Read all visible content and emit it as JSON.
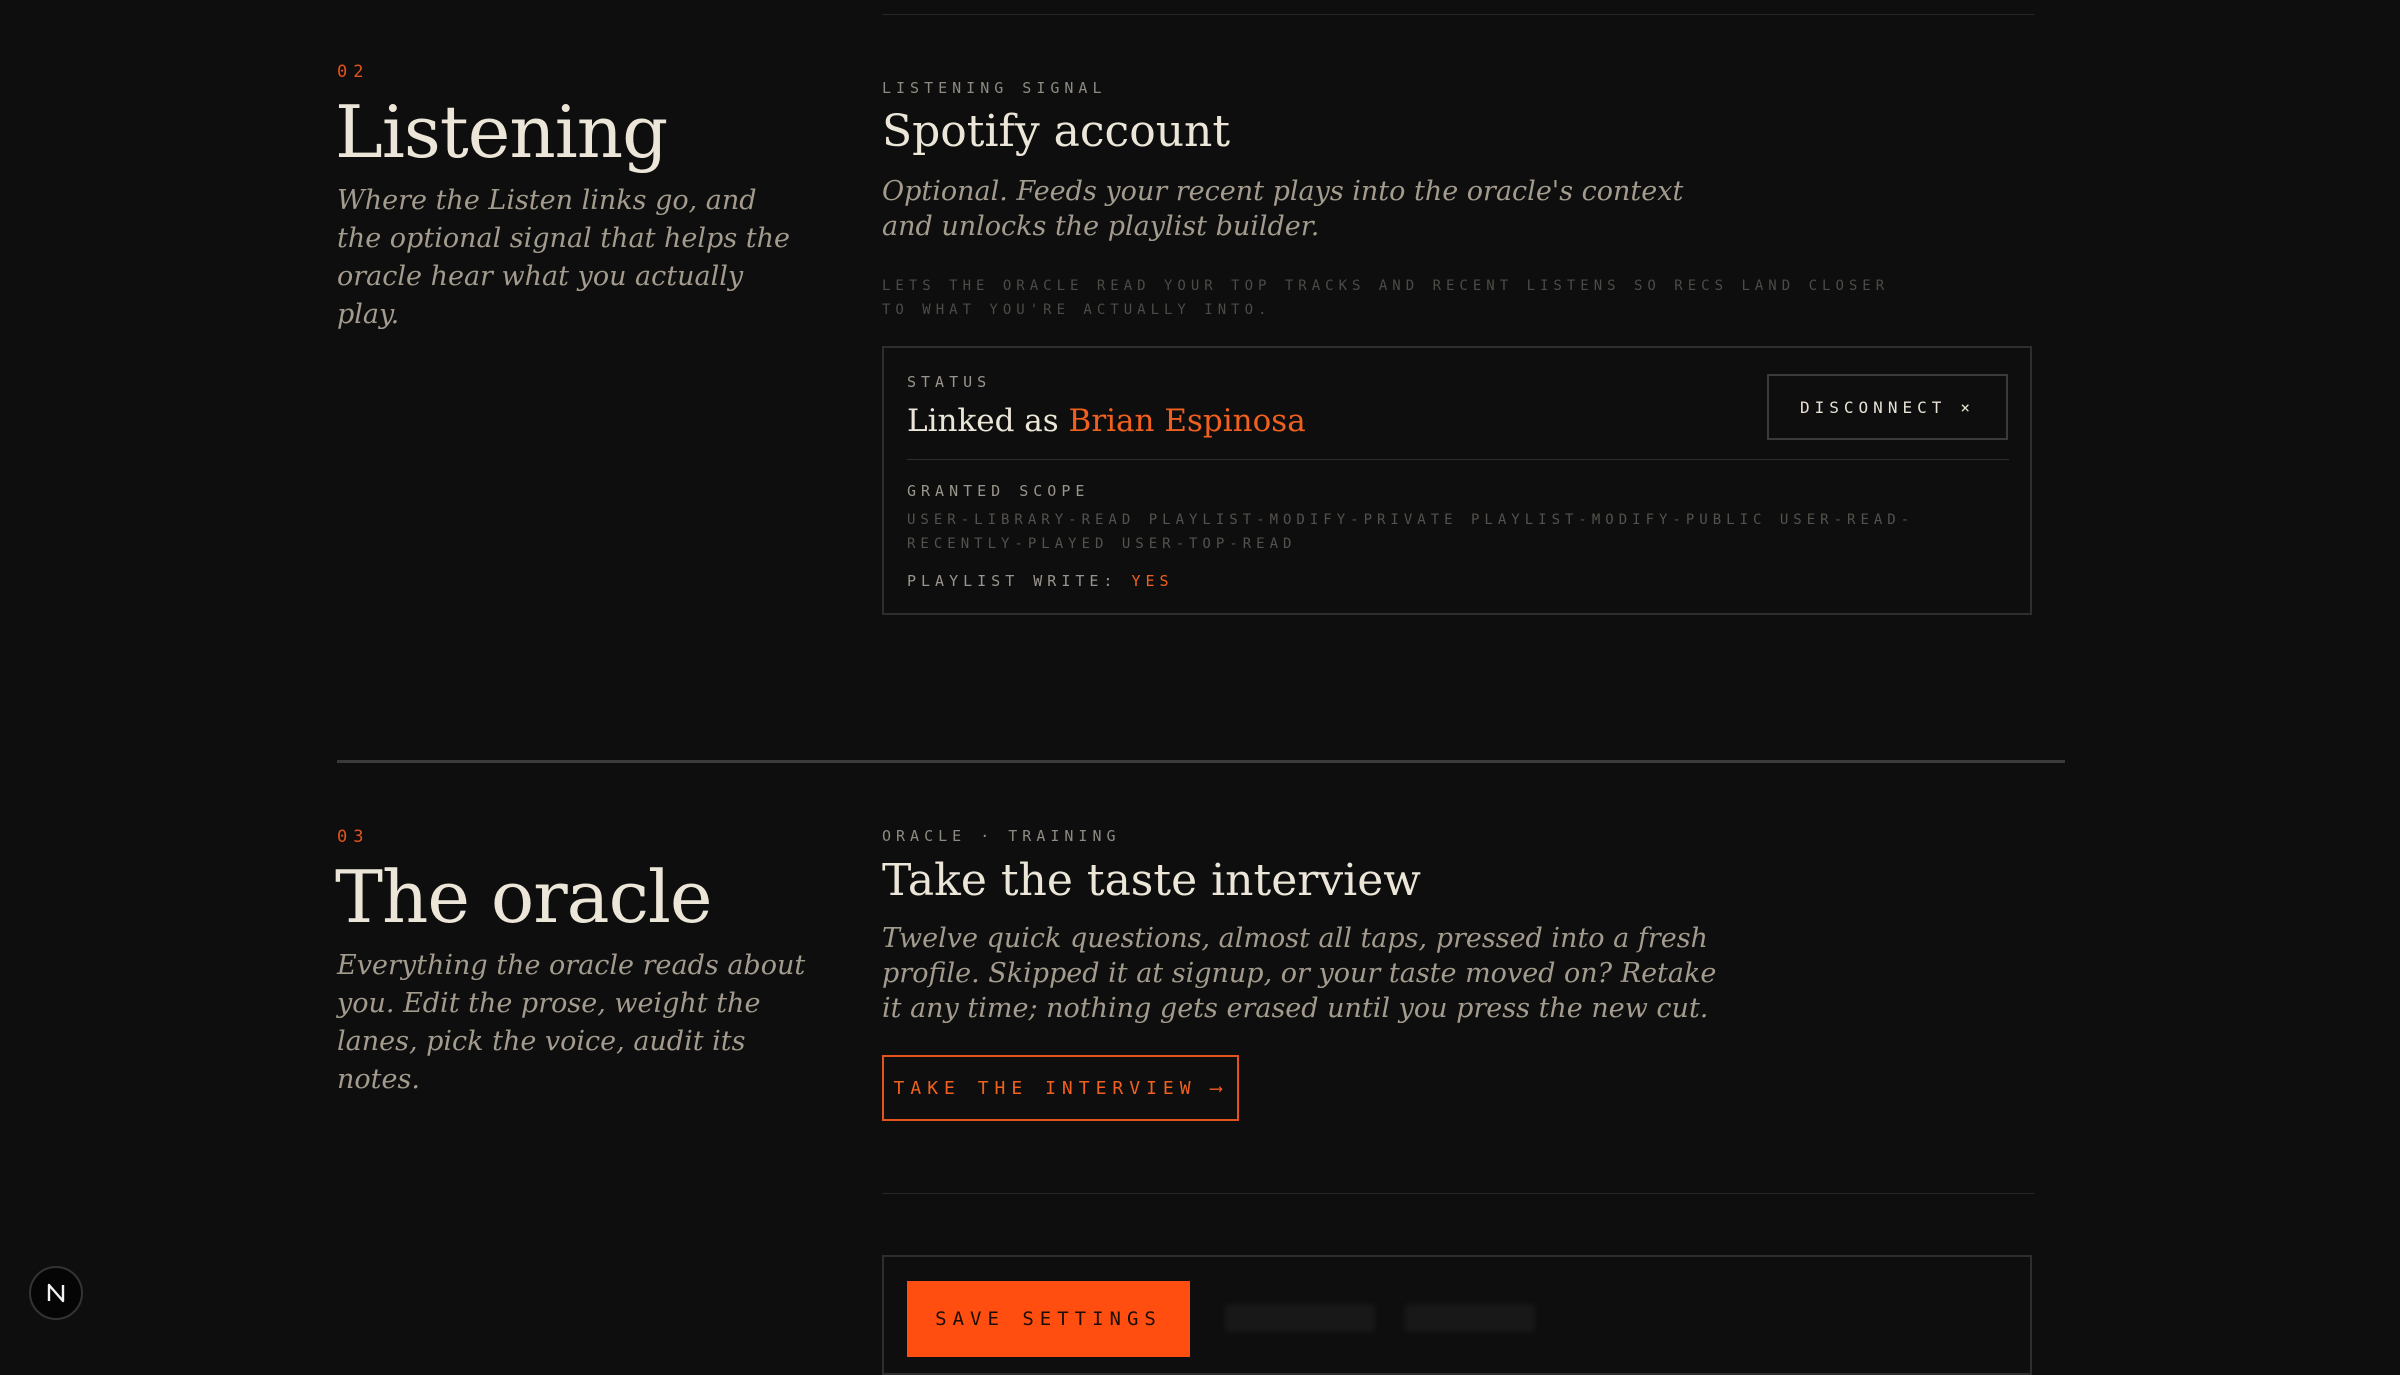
{
  "colors": {
    "background": "#0e0e0e",
    "accent": "#f0601f",
    "accent_button": "#ff4e0f",
    "text": "#ece6d9",
    "muted": "#a39b8d"
  },
  "listening": {
    "number": "02",
    "title": "Listening",
    "description": "Where the Listen links go, and the optional signal that helps the oracle hear what you actually play.",
    "eyebrow": "LISTENING SIGNAL",
    "card_title": "Spotify account",
    "card_description": "Optional. Feeds your recent plays into the oracle's context and unlocks the playlist builder.",
    "fine_print": "LETS THE ORACLE READ YOUR TOP TRACKS AND RECENT LISTENS SO RECS LAND CLOSER TO WHAT YOU'RE ACTUALLY INTO.",
    "status": {
      "label": "STATUS",
      "linked_prefix": "Linked as",
      "user_name": "Brian Espinosa",
      "disconnect_label": "DISCONNECT",
      "disconnect_icon": "close-icon",
      "scope_label": "GRANTED SCOPE",
      "scope_values": "USER-LIBRARY-READ PLAYLIST-MODIFY-PRIVATE PLAYLIST-MODIFY-PUBLIC USER-READ-RECENTLY-PLAYED USER-TOP-READ",
      "playlist_write_label": "PLAYLIST WRITE:",
      "playlist_write_value": "YES"
    }
  },
  "oracle": {
    "number": "03",
    "title": "The oracle",
    "description": "Everything the oracle reads about you. Edit the prose, weight the lanes, pick the voice, audit its notes.",
    "eyebrow": "ORACLE · TRAINING",
    "card_title": "Take the taste interview",
    "card_description": "Twelve quick questions, almost all taps, pressed into a fresh profile. Skipped it at signup, or your taste moved on? Retake it any time; nothing gets erased until you press the new cut.",
    "interview_button_label": "TAKE THE INTERVIEW",
    "interview_button_icon": "arrow-right-icon"
  },
  "footer": {
    "save_label": "SAVE SETTINGS",
    "badge_letter": "N",
    "badge_icon": "nextjs-logo-icon"
  }
}
